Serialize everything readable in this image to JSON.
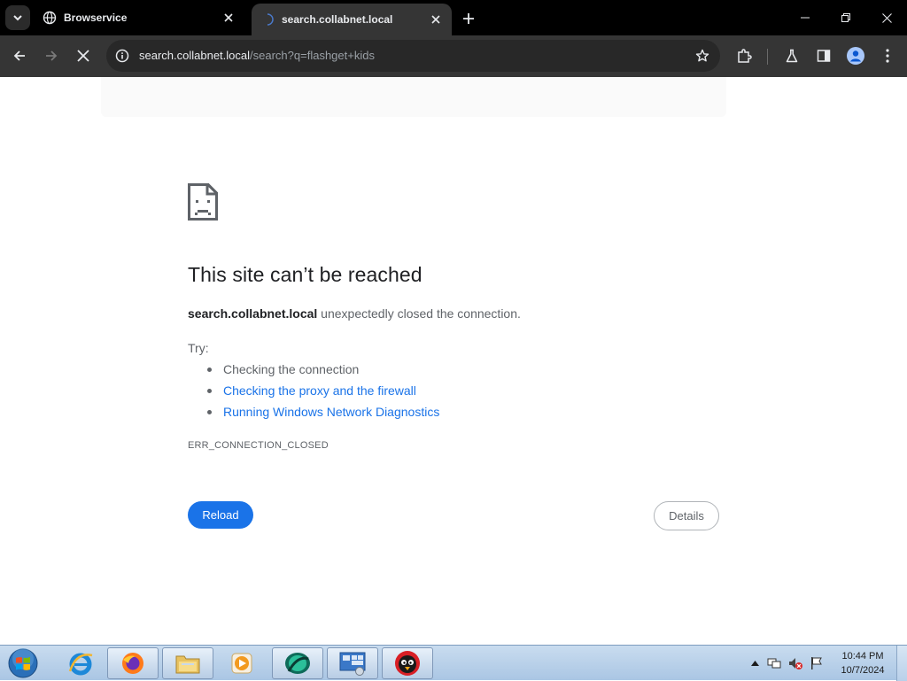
{
  "browser": {
    "tabs": [
      {
        "title": "Browservice",
        "favicon": "globe-icon"
      },
      {
        "title": "search.collabnet.local",
        "favicon": "loading-icon"
      }
    ],
    "address": {
      "host": "search.collabnet.local",
      "path": "/search?q=flashget+kids"
    }
  },
  "error": {
    "title": "This site can’t be reached",
    "host": "search.collabnet.local",
    "message": " unexpectedly closed the connection.",
    "try_label": "Try:",
    "suggestions": [
      "Checking the connection",
      "Checking the proxy and the firewall",
      "Running Windows Network Diagnostics"
    ],
    "code": "ERR_CONNECTION_CLOSED",
    "reload_label": "Reload",
    "details_label": "Details"
  },
  "taskbar": {
    "apps": [
      "internet-explorer-icon",
      "firefox-icon",
      "file-explorer-icon",
      "media-player-icon",
      "browser-app-icon",
      "control-panel-icon",
      "angry-bird-icon"
    ],
    "time": "10:44 PM",
    "date": "10/7/2024"
  },
  "colors": {
    "accent": "#1a73e8",
    "chrome_dark": "#353535",
    "tab_strip": "#000000"
  }
}
